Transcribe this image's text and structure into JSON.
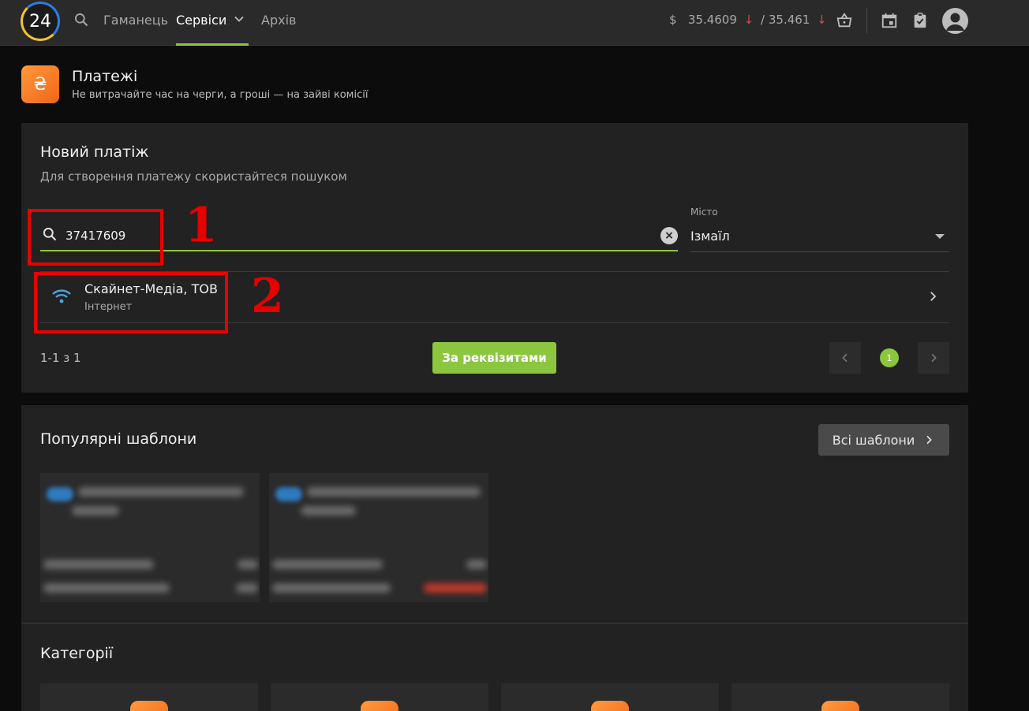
{
  "topbar": {
    "logo_text": "24",
    "nav": [
      "Гаманець",
      "Сервіси",
      "Архів"
    ],
    "rates": {
      "currency_symbol": "$",
      "buy": "35.4609",
      "sell": "/ 35.461",
      "arrow": "↓"
    }
  },
  "header": {
    "title": "Платежі",
    "subtitle": "Не витрачайте час на черги, а гроші — на зайві комісії",
    "icon_glyph": "₴"
  },
  "new_payment": {
    "title": "Новий платіж",
    "subtitle": "Для створення платежу скористайтеся пошуком",
    "search_value": "37417609",
    "city_label": "Місто",
    "city_value": "Ізмаїл",
    "result": {
      "name": "Скайнет-Медіа, ТОВ",
      "category": "Інтернет"
    },
    "range_text": "1-1 з 1",
    "req_button": "За реквізитами",
    "current_page": "1"
  },
  "templates": {
    "title": "Популярні шаблони",
    "all_button": "Всі шаблони"
  },
  "categories": {
    "title": "Категорії"
  },
  "annotations": [
    "1",
    "2"
  ],
  "colors": {
    "accent": "#8cc63f",
    "annotation": "#e60000",
    "orange": "#f26419"
  }
}
